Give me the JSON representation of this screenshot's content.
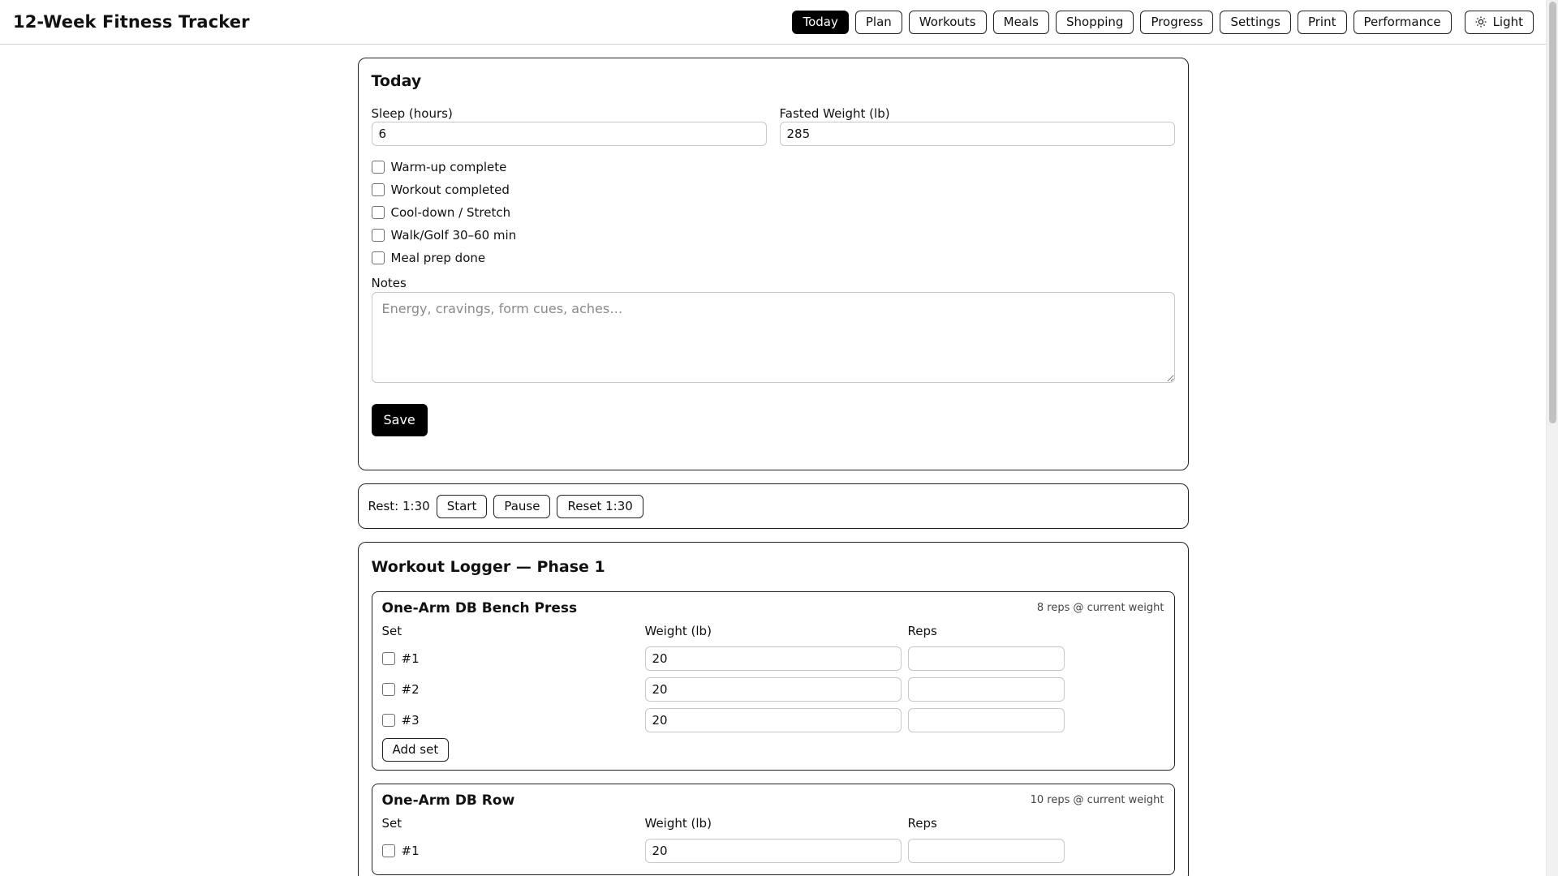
{
  "app": {
    "title": "12-Week Fitness Tracker"
  },
  "nav": {
    "items": [
      {
        "label": "Today",
        "active": true
      },
      {
        "label": "Plan"
      },
      {
        "label": "Workouts"
      },
      {
        "label": "Meals"
      },
      {
        "label": "Shopping"
      },
      {
        "label": "Progress"
      },
      {
        "label": "Settings"
      },
      {
        "label": "Print"
      },
      {
        "label": "Performance"
      }
    ],
    "theme": {
      "label": "Light",
      "icon": "sun-icon"
    }
  },
  "today": {
    "title": "Today",
    "sleep": {
      "label": "Sleep (hours)",
      "value": "6"
    },
    "weight": {
      "label": "Fasted Weight (lb)",
      "value": "285"
    },
    "checklist": [
      {
        "label": "Warm-up complete",
        "checked": false
      },
      {
        "label": "Workout completed",
        "checked": false
      },
      {
        "label": "Cool-down / Stretch",
        "checked": false
      },
      {
        "label": "Walk/Golf 30–60 min",
        "checked": false
      },
      {
        "label": "Meal prep done",
        "checked": false
      }
    ],
    "notes": {
      "label": "Notes",
      "placeholder": "Energy, cravings, form cues, aches…",
      "value": ""
    },
    "save_label": "Save"
  },
  "timer": {
    "text": "Rest: 1:30",
    "start_label": "Start",
    "pause_label": "Pause",
    "reset_label": "Reset 1:30"
  },
  "logger": {
    "title": "Workout Logger — Phase 1",
    "columns": {
      "set": "Set",
      "weight": "Weight (lb)",
      "reps": "Reps"
    },
    "add_set_label": "Add set",
    "exercises": [
      {
        "name": "One-Arm DB Bench Press",
        "hint": "8 reps @ current weight",
        "sets": [
          {
            "label": "#1",
            "weight": "20",
            "reps": ""
          },
          {
            "label": "#2",
            "weight": "20",
            "reps": ""
          },
          {
            "label": "#3",
            "weight": "20",
            "reps": ""
          }
        ]
      },
      {
        "name": "One-Arm DB Row",
        "hint": "10 reps @ current weight",
        "sets": [
          {
            "label": "#1",
            "weight": "20",
            "reps": ""
          }
        ]
      }
    ]
  },
  "colors": {
    "accent": "#000000",
    "border": "#222222",
    "input_border": "#c8c8c8",
    "background": "#ffffff"
  }
}
